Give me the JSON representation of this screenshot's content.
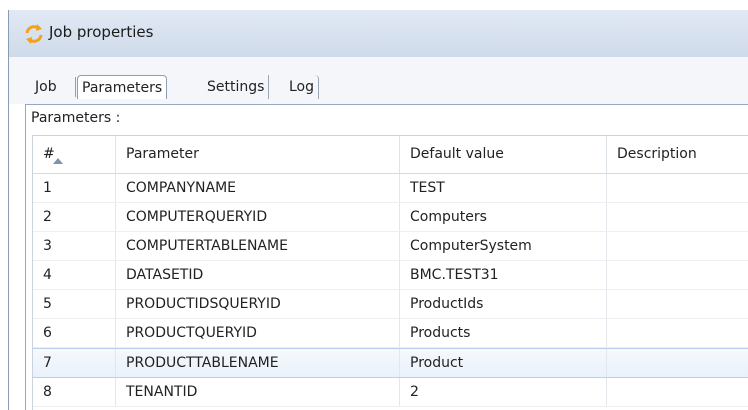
{
  "window": {
    "title": "Job properties"
  },
  "tabs": [
    {
      "label": "Job"
    },
    {
      "label": "Parameters"
    },
    {
      "label": "Settings"
    },
    {
      "label": "Log"
    }
  ],
  "section_label": "Parameters :",
  "table": {
    "columns": [
      "#",
      "Parameter",
      "Default value",
      "Description"
    ],
    "rows": [
      {
        "num": "1",
        "param": "COMPANYNAME",
        "value": "TEST",
        "desc": ""
      },
      {
        "num": "2",
        "param": "COMPUTERQUERYID",
        "value": "Computers",
        "desc": ""
      },
      {
        "num": "3",
        "param": "COMPUTERTABLENAME",
        "value": "ComputerSystem",
        "desc": ""
      },
      {
        "num": "4",
        "param": "DATASETID",
        "value": "BMC.TEST31",
        "desc": ""
      },
      {
        "num": "5",
        "param": "PRODUCTIDSQUERYID",
        "value": "ProductIds",
        "desc": ""
      },
      {
        "num": "6",
        "param": "PRODUCTQUERYID",
        "value": "Products",
        "desc": ""
      },
      {
        "num": "7",
        "param": "PRODUCTTABLENAME",
        "value": "Product",
        "desc": ""
      },
      {
        "num": "8",
        "param": "TENANTID",
        "value": "2",
        "desc": ""
      }
    ],
    "selected_row": 7
  },
  "icons": {
    "title_icon": "refresh-arrows-icon",
    "sort_icon": "sort-ascending-icon"
  },
  "colors": {
    "titlebar": "#d8e3f0",
    "selection": "#e9f1fb",
    "icon_orange": "#f5a11c"
  }
}
